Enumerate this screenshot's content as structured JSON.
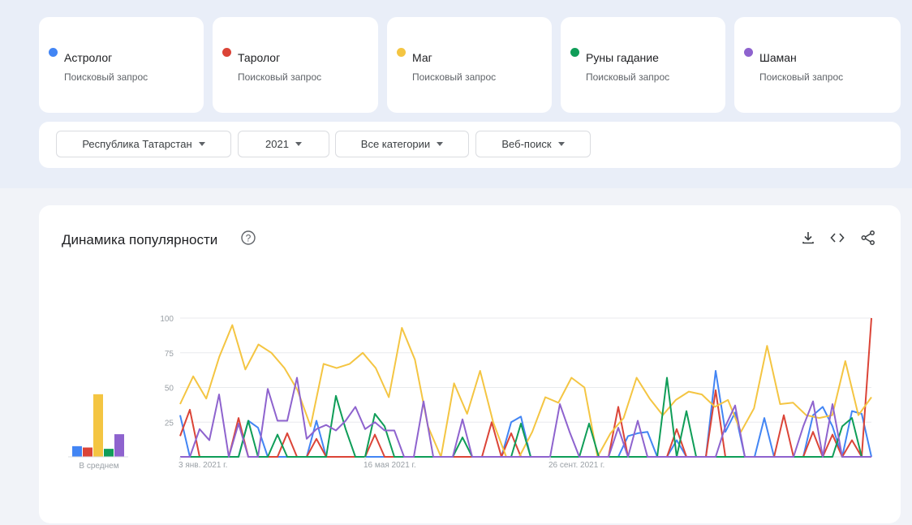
{
  "terms": [
    {
      "label": "Астролог",
      "sublabel": "Поисковый запрос",
      "color": "#4285f4"
    },
    {
      "label": "Таролог",
      "sublabel": "Поисковый запрос",
      "color": "#db4437"
    },
    {
      "label": "Маг",
      "sublabel": "Поисковый запрос",
      "color": "#f4c542"
    },
    {
      "label": "Руны гадание",
      "sublabel": "Поисковый запрос",
      "color": "#0f9d58"
    },
    {
      "label": "Шаман",
      "sublabel": "Поисковый запрос",
      "color": "#8e63ce"
    }
  ],
  "filters": [
    {
      "label": "Республика Татарстан"
    },
    {
      "label": "2021"
    },
    {
      "label": "Все категории"
    },
    {
      "label": "Веб-поиск"
    }
  ],
  "panel": {
    "title": "Динамика популярности"
  },
  "icons": [
    "help-icon",
    "download-icon",
    "embed-icon",
    "share-icon"
  ],
  "chart_data": {
    "type": "line",
    "title": "Динамика популярности",
    "ylim": [
      0,
      100
    ],
    "yticks": [
      25,
      50,
      75,
      100
    ],
    "grid": true,
    "x_tick_labels": [
      {
        "index": 0,
        "label": "3 янв. 2021 г."
      },
      {
        "index": 19,
        "label": "16 мая 2021 г."
      },
      {
        "index": 38,
        "label": "26 сент. 2021 г."
      }
    ],
    "average": {
      "label": "В среднем",
      "values": [
        8,
        7,
        47,
        6,
        17
      ]
    },
    "series": [
      {
        "name": "Астролог",
        "color": "#4285f4",
        "values": [
          30,
          0,
          0,
          0,
          0,
          0,
          0,
          26,
          21,
          0,
          0,
          0,
          0,
          0,
          26,
          0,
          0,
          0,
          0,
          0,
          0,
          0,
          0,
          0,
          0,
          0,
          0,
          0,
          0,
          0,
          0,
          0,
          0,
          0,
          25,
          29,
          0,
          0,
          0,
          0,
          0,
          0,
          0,
          0,
          0,
          0,
          15,
          17,
          18,
          0,
          0,
          12,
          0,
          0,
          0,
          62,
          18,
          32,
          0,
          0,
          28,
          0,
          0,
          0,
          0,
          30,
          36,
          22,
          0,
          33,
          31,
          0
        ]
      },
      {
        "name": "Таролог",
        "color": "#db4437",
        "values": [
          15,
          34,
          0,
          0,
          0,
          0,
          28,
          0,
          0,
          0,
          0,
          17,
          0,
          0,
          13,
          0,
          0,
          0,
          0,
          0,
          16,
          0,
          0,
          0,
          0,
          0,
          0,
          0,
          0,
          0,
          0,
          0,
          25,
          0,
          17,
          0,
          0,
          0,
          0,
          0,
          0,
          0,
          0,
          0,
          0,
          36,
          0,
          0,
          0,
          0,
          0,
          20,
          0,
          0,
          0,
          48,
          0,
          0,
          0,
          0,
          0,
          0,
          30,
          0,
          0,
          18,
          0,
          16,
          0,
          12,
          0,
          100
        ]
      },
      {
        "name": "Маг",
        "color": "#f4c542",
        "values": [
          38,
          58,
          42,
          72,
          95,
          63,
          81,
          75,
          64,
          48,
          22,
          67,
          64,
          67,
          75,
          64,
          43,
          93,
          70,
          22,
          0,
          53,
          31,
          62,
          25,
          0,
          0,
          18,
          43,
          39,
          57,
          50,
          0,
          17,
          28,
          57,
          42,
          30,
          41,
          47,
          45,
          36,
          41,
          18,
          35,
          80,
          38,
          39,
          30,
          28,
          30,
          69,
          30,
          43
        ]
      },
      {
        "name": "Руны гадание",
        "color": "#0f9d58",
        "values": [
          0,
          0,
          0,
          0,
          0,
          0,
          0,
          26,
          0,
          0,
          16,
          0,
          0,
          0,
          0,
          0,
          44,
          20,
          0,
          0,
          31,
          22,
          0,
          0,
          0,
          0,
          0,
          0,
          0,
          14,
          0,
          0,
          0,
          0,
          0,
          24,
          0,
          0,
          0,
          0,
          0,
          0,
          24,
          0,
          0,
          0,
          0,
          0,
          0,
          0,
          57,
          0,
          33,
          0,
          0,
          0,
          0,
          0,
          0,
          0,
          0,
          0,
          0,
          0,
          0,
          0,
          0,
          0,
          22,
          28,
          0,
          0
        ]
      },
      {
        "name": "Шаман",
        "color": "#8e63ce",
        "values": [
          0,
          0,
          20,
          12,
          45,
          0,
          24,
          0,
          0,
          49,
          26,
          26,
          57,
          13,
          20,
          23,
          19,
          26,
          36,
          20,
          25,
          19,
          19,
          0,
          0,
          40,
          0,
          0,
          0,
          27,
          0,
          0,
          0,
          0,
          0,
          0,
          0,
          0,
          0,
          38,
          18,
          0,
          0,
          0,
          0,
          21,
          0,
          26,
          0,
          0,
          0,
          0,
          0,
          0,
          0,
          0,
          22,
          37,
          0,
          0,
          0,
          0,
          0,
          0,
          22,
          40,
          0,
          38,
          0,
          0,
          0,
          0
        ]
      }
    ]
  }
}
